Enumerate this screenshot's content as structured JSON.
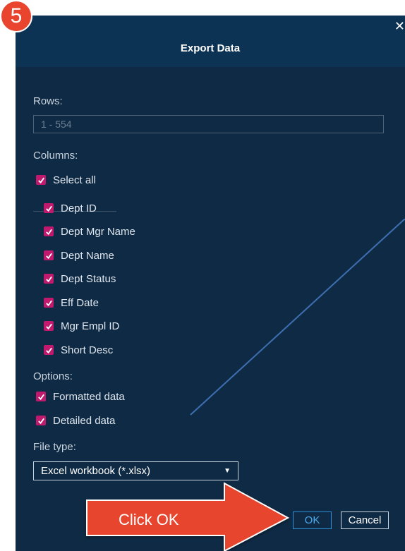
{
  "step": {
    "number": "5"
  },
  "dialog": {
    "title": "Export Data",
    "close_icon": "close-icon",
    "rows": {
      "label": "Rows:",
      "value": "1 - 554"
    },
    "columns": {
      "label": "Columns:",
      "select_all": {
        "label": "Select all",
        "checked": true
      },
      "items": [
        {
          "label": "Dept ID",
          "checked": true
        },
        {
          "label": "Dept Mgr Name",
          "checked": true
        },
        {
          "label": "Dept Name",
          "checked": true
        },
        {
          "label": "Dept Status",
          "checked": true
        },
        {
          "label": "Eff Date",
          "checked": true
        },
        {
          "label": "Mgr Empl ID",
          "checked": true
        },
        {
          "label": "Short Desc",
          "checked": true
        }
      ]
    },
    "options": {
      "label": "Options:",
      "items": [
        {
          "label": "Formatted data",
          "checked": true
        },
        {
          "label": "Detailed data",
          "checked": true
        }
      ]
    },
    "file_type": {
      "label": "File type:",
      "value": "Excel workbook (*.xlsx)"
    },
    "buttons": {
      "ok": "OK",
      "cancel": "Cancel"
    }
  },
  "callout": {
    "text": "Click OK"
  },
  "colors": {
    "dialog_bg": "#0f2a44",
    "titlebar_bg": "#0d3354",
    "checkbox": "#c0196d",
    "badge": "#e8442e",
    "callout": "#e8442e",
    "ok_accent": "#2e8fd6"
  }
}
